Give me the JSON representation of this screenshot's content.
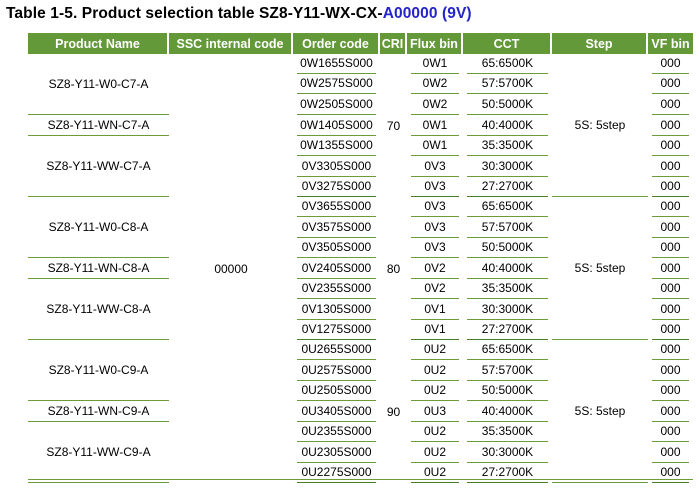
{
  "title": {
    "main": "Table 1-5. Product selection table SZ8-Y11-WX-CX-",
    "suffix": "A00000 (9V)"
  },
  "headers": [
    "Product Name",
    "SSC internal code",
    "Order code",
    "CRI",
    "Flux bin",
    "CCT",
    "Step",
    "VF bin"
  ],
  "ssc_internal_code": "00000",
  "groups": [
    {
      "cri": "70",
      "step": "5S: 5step",
      "products": [
        {
          "name": "SZ8-Y11-W0-C7-A",
          "rows": 3
        },
        {
          "name": "SZ8-Y11-WN-C7-A",
          "rows": 1
        },
        {
          "name": "SZ8-Y11-WW-C7-A",
          "rows": 3
        }
      ],
      "rows": [
        {
          "order": "0W1655S000",
          "flux": "0W1",
          "cct": "65:6500K",
          "vf": "000"
        },
        {
          "order": "0W2575S000",
          "flux": "0W2",
          "cct": "57:5700K",
          "vf": "000"
        },
        {
          "order": "0W2505S000",
          "flux": "0W2",
          "cct": "50:5000K",
          "vf": "000"
        },
        {
          "order": "0W1405S000",
          "flux": "0W1",
          "cct": "40:4000K",
          "vf": "000"
        },
        {
          "order": "0W1355S000",
          "flux": "0W1",
          "cct": "35:3500K",
          "vf": "000"
        },
        {
          "order": "0V3305S000",
          "flux": "0V3",
          "cct": "30:3000K",
          "vf": "000"
        },
        {
          "order": "0V3275S000",
          "flux": "0V3",
          "cct": "27:2700K",
          "vf": "000"
        }
      ]
    },
    {
      "cri": "80",
      "step": "5S: 5step",
      "products": [
        {
          "name": "SZ8-Y11-W0-C8-A",
          "rows": 3
        },
        {
          "name": "SZ8-Y11-WN-C8-A",
          "rows": 1
        },
        {
          "name": "SZ8-Y11-WW-C8-A",
          "rows": 3
        }
      ],
      "rows": [
        {
          "order": "0V3655S000",
          "flux": "0V3",
          "cct": "65:6500K",
          "vf": "000"
        },
        {
          "order": "0V3575S000",
          "flux": "0V3",
          "cct": "57:5700K",
          "vf": "000"
        },
        {
          "order": "0V3505S000",
          "flux": "0V3",
          "cct": "50:5000K",
          "vf": "000"
        },
        {
          "order": "0V2405S000",
          "flux": "0V2",
          "cct": "40:4000K",
          "vf": "000"
        },
        {
          "order": "0V2355S000",
          "flux": "0V2",
          "cct": "35:3500K",
          "vf": "000"
        },
        {
          "order": "0V1305S000",
          "flux": "0V1",
          "cct": "30:3000K",
          "vf": "000"
        },
        {
          "order": "0V1275S000",
          "flux": "0V1",
          "cct": "27:2700K",
          "vf": "000"
        }
      ]
    },
    {
      "cri": "90",
      "step": "5S: 5step",
      "products": [
        {
          "name": "SZ8-Y11-W0-C9-A",
          "rows": 3
        },
        {
          "name": "SZ8-Y11-WN-C9-A",
          "rows": 1
        },
        {
          "name": "SZ8-Y11-WW-C9-A",
          "rows": 3
        }
      ],
      "rows": [
        {
          "order": "0U2655S000",
          "flux": "0U2",
          "cct": "65:6500K",
          "vf": "000"
        },
        {
          "order": "0U2575S000",
          "flux": "0U2",
          "cct": "57:5700K",
          "vf": "000"
        },
        {
          "order": "0U2505S000",
          "flux": "0U2",
          "cct": "50:5000K",
          "vf": "000"
        },
        {
          "order": "0U3405S000",
          "flux": "0U3",
          "cct": "40:4000K",
          "vf": "000"
        },
        {
          "order": "0U2355S000",
          "flux": "0U2",
          "cct": "35:3500K",
          "vf": "000"
        },
        {
          "order": "0U2305S000",
          "flux": "0U2",
          "cct": "30:3000K",
          "vf": "000"
        },
        {
          "order": "0U2275S000",
          "flux": "0U2",
          "cct": "27:2700K",
          "vf": "000"
        }
      ]
    }
  ],
  "colors": {
    "header_bg": "#64993a",
    "header_text": "#ffffff",
    "title_suffix": "#2424c8",
    "rule": "#6b9b3c"
  }
}
